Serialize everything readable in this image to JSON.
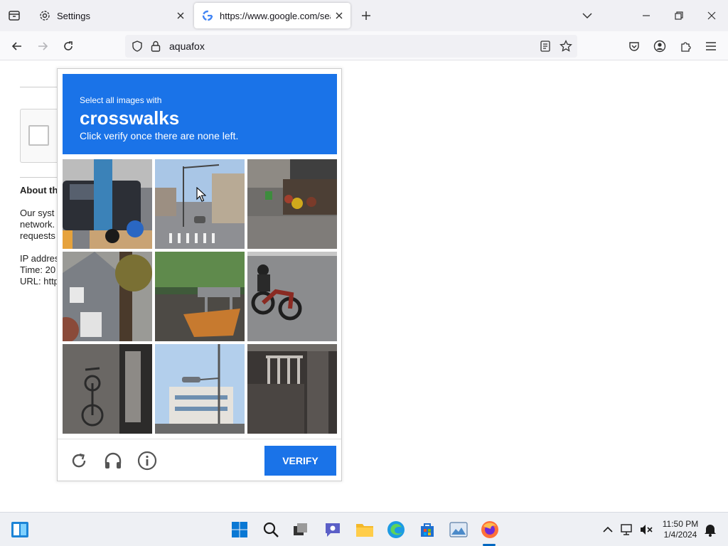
{
  "browser": {
    "tabs": [
      {
        "label": "Settings",
        "icon": "gear-icon"
      },
      {
        "label": "https://www.google.com/search",
        "icon": "google-icon"
      }
    ],
    "address": "aquafox"
  },
  "page": {
    "heading": "About th",
    "para1": [
      "Our syst",
      "network.",
      "requests"
    ],
    "para2": [
      "IP addres",
      "Time: 20",
      "URL: http"
    ]
  },
  "captcha": {
    "line1": "Select all images with",
    "target": "crosswalks",
    "line3": "Click verify once there are none left.",
    "tiles": [
      "scooter-parked-by-sign",
      "street-crosswalk",
      "street-market",
      "house-with-tree",
      "cafe-chairs",
      "motorcycle-on-road",
      "bicycle-by-wall",
      "traffic-light-building",
      "gate-fence"
    ],
    "verify_label": "VERIFY"
  },
  "taskbar": {
    "time": "11:50 PM",
    "date": "1/4/2024"
  },
  "colors": {
    "captcha_blue": "#1a73e8",
    "taskbar_bg": "#eef0f4"
  }
}
